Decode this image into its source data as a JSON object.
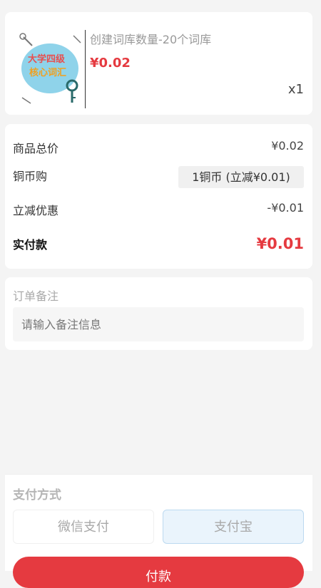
{
  "product": {
    "name": "创建词库数量-20个词库",
    "price": "¥0.02",
    "quantity": "x1",
    "image_text_line1": "大学四级",
    "image_text_line2": "核心词汇"
  },
  "summary": {
    "total_price_label": "商品总价",
    "total_price_value": "¥0.02",
    "coin_label": "铜币购",
    "coin_value": "1铜币 (立减¥0.01)",
    "discount_label": "立减优惠",
    "discount_value": "-¥0.01",
    "pay_amount_label": "实付款",
    "pay_amount_value": "¥0.01"
  },
  "remark": {
    "title": "订单备注",
    "placeholder": "请输入备注信息"
  },
  "payment": {
    "title": "支付方式",
    "wechat_label": "微信支付",
    "alipay_label": "支付宝",
    "pay_button_label": "付款",
    "selected": "alipay"
  },
  "colors": {
    "accent_red": "#e53a40",
    "alipay_bg": "#eaf4fc"
  }
}
